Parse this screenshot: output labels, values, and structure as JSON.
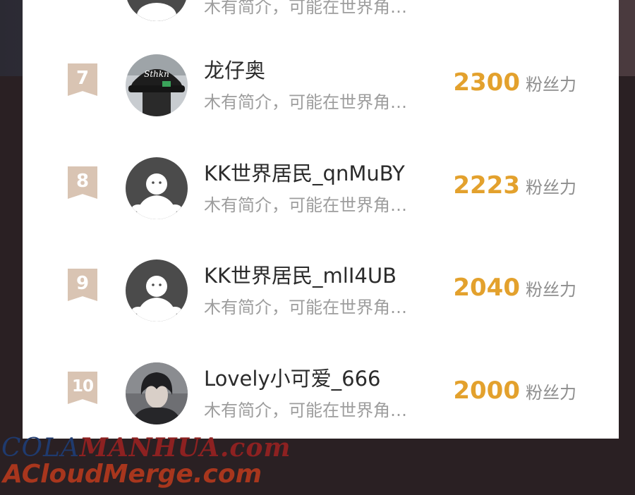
{
  "partial_row": {
    "bio": "木有简介，可能在世界角…"
  },
  "rows": [
    {
      "rank": "7",
      "name": "龙仔奥",
      "bio": "木有简介，可能在世界角…",
      "fans": "2300",
      "fans_label": "粉丝力"
    },
    {
      "rank": "8",
      "name": "KK世界居民_qnMuBY",
      "bio": "木有简介，可能在世界角…",
      "fans": "2223",
      "fans_label": "粉丝力"
    },
    {
      "rank": "9",
      "name": "KK世界居民_mlI4UB",
      "bio": "木有简介，可能在世界角…",
      "fans": "2040",
      "fans_label": "粉丝力"
    },
    {
      "rank": "10",
      "name": "Lovely小可爱_666",
      "bio": "木有简介，可能在世界角…",
      "fans": "2000",
      "fans_label": "粉丝力"
    }
  ],
  "watermark": {
    "line1_a": "COLA",
    "line1_b": "MANHUA.com",
    "line2": "ACloudMerge.com"
  },
  "colors": {
    "accent": "#e3a12d",
    "rank_badge": "#d9c4b3"
  }
}
